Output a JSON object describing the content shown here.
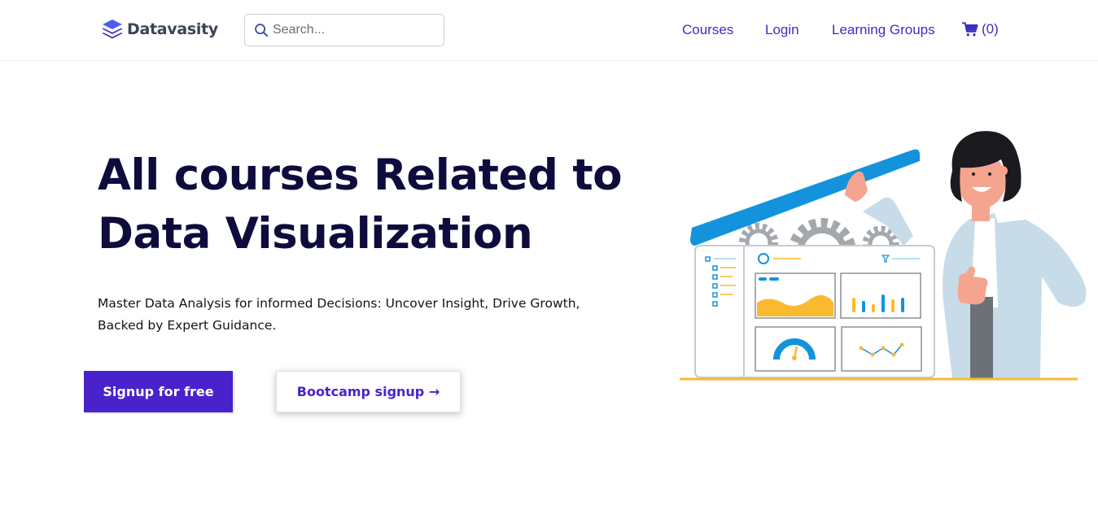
{
  "header": {
    "logo_text": "Datavasity",
    "search_placeholder": "Search...",
    "nav": {
      "courses": "Courses",
      "login": "Login",
      "learning_groups": "Learning Groups"
    },
    "cart": {
      "icon": "cart-icon",
      "count_label": "(0)"
    }
  },
  "hero": {
    "title": "All courses Related to Data Visualization",
    "subtitle": "Master Data Analysis for informed Decisions: Uncover Insight, Drive Growth, Backed by Expert Guidance.",
    "primary_button": "Signup for free",
    "secondary_button": "Bootcamp signup →"
  },
  "colors": {
    "accent": "#4a22cc",
    "nav_link": "#3b2fbf",
    "title": "#0e0b3d",
    "illustration_blue": "#1493dd",
    "illustration_yellow": "#fbb92f"
  },
  "icons": [
    "logo-stack-icon",
    "search-icon",
    "cart-icon"
  ]
}
